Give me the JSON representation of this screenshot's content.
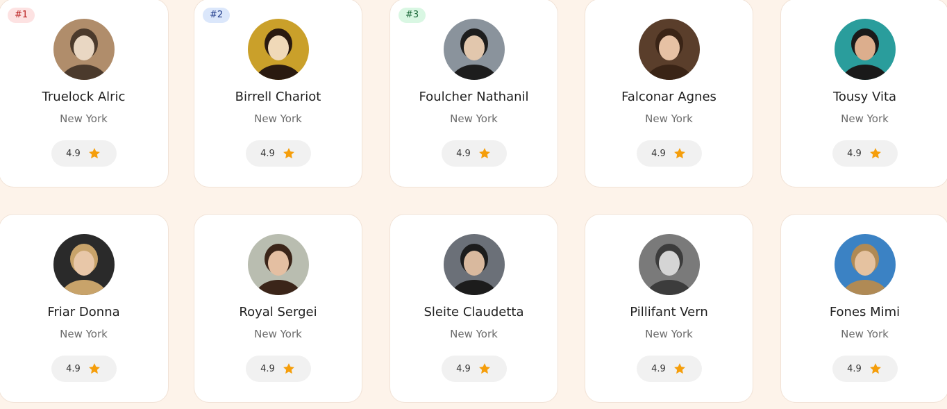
{
  "colors": {
    "background": "#fdf3ea",
    "card": "#ffffff",
    "star": "#f59e0b",
    "rating_pill": "#f1f1f1"
  },
  "rating_icon": "star-icon",
  "cards": [
    {
      "rank": "#1",
      "name": "Truelock Alric",
      "city": "New York",
      "rating": "4.9",
      "rank_bg": "#fde2e2",
      "rank_fg": "#b91c1c",
      "avatar_colors": [
        "#b08d6b",
        "#e9d7c3",
        "#4b3a2c"
      ]
    },
    {
      "rank": "#2",
      "name": "Birrell Chariot",
      "city": "New York",
      "rating": "4.9",
      "rank_bg": "#dbe7fb",
      "rank_fg": "#1e3a8a",
      "avatar_colors": [
        "#caa02a",
        "#f0d9b8",
        "#2a1a10"
      ]
    },
    {
      "rank": "#3",
      "name": "Foulcher Nathanil",
      "city": "New York",
      "rating": "4.9",
      "rank_bg": "#d9f7e3",
      "rank_fg": "#166534",
      "avatar_colors": [
        "#8a939c",
        "#e2c7ad",
        "#1d1d1d"
      ]
    },
    {
      "name": "Falconar Agnes",
      "city": "New York",
      "rating": "4.9",
      "avatar_colors": [
        "#5a3e2b",
        "#e6c1a4",
        "#3a2416"
      ]
    },
    {
      "name": "Tousy Vita",
      "city": "New York",
      "rating": "4.9",
      "avatar_colors": [
        "#2a9d9c",
        "#dcae8d",
        "#1a1a1a"
      ]
    },
    {
      "name": "Friar Donna",
      "city": "New York",
      "rating": "4.9",
      "avatar_colors": [
        "#2a2a2a",
        "#e8c7a8",
        "#c8a36a"
      ]
    },
    {
      "name": "Royal Sergei",
      "city": "New York",
      "rating": "4.9",
      "avatar_colors": [
        "#b9bdb0",
        "#e4bfa2",
        "#3b2519"
      ]
    },
    {
      "name": "Sleite Claudetta",
      "city": "New York",
      "rating": "4.9",
      "avatar_colors": [
        "#6b7078",
        "#d9b99e",
        "#1c1c1c"
      ]
    },
    {
      "name": "Pillifant Vern",
      "city": "New York",
      "rating": "4.9",
      "avatar_colors": [
        "#7a7a7a",
        "#d5d5d5",
        "#3c3c3c"
      ]
    },
    {
      "name": "Fones Mimi",
      "city": "New York",
      "rating": "4.9",
      "avatar_colors": [
        "#3b82c4",
        "#e5c2a0",
        "#b08a55"
      ]
    }
  ]
}
